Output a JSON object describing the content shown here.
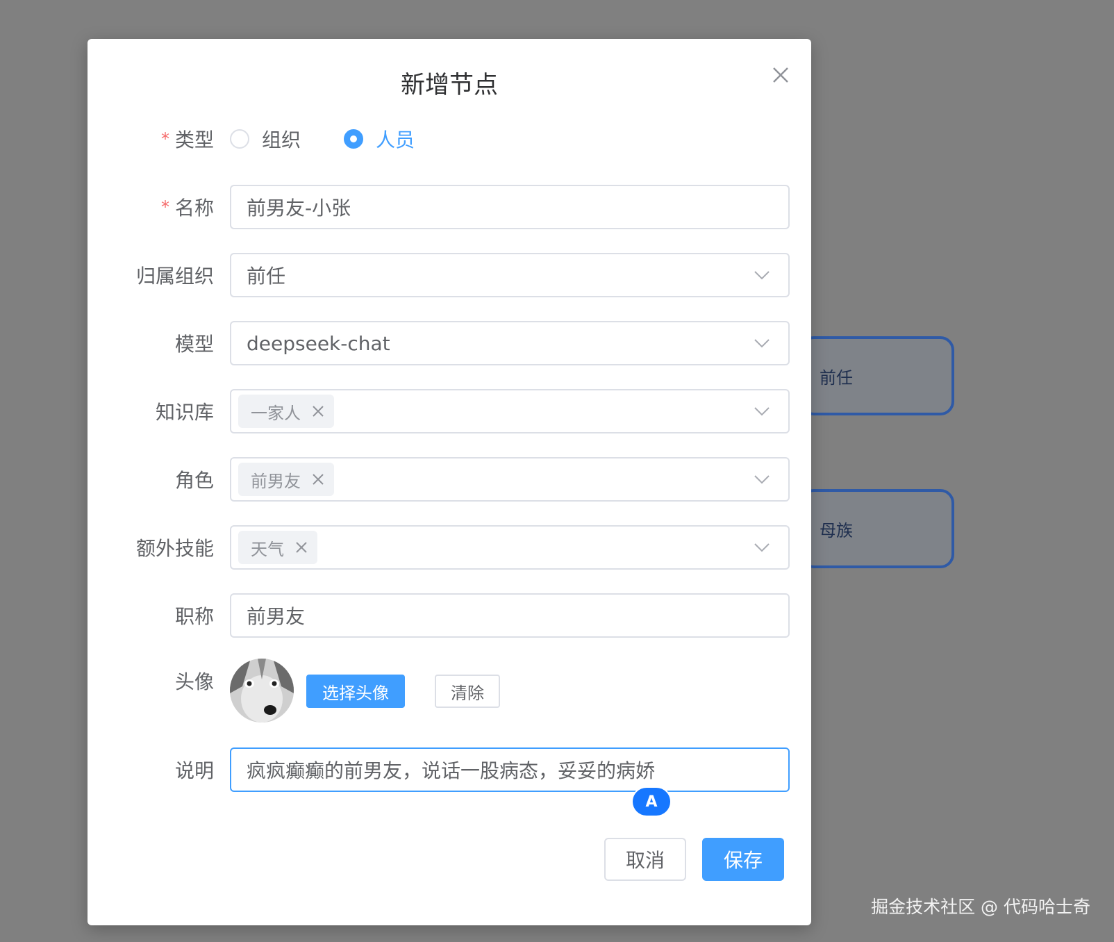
{
  "background": {
    "nodes": [
      "前任",
      "母族"
    ],
    "watermark": "掘金技术社区 @ 代码哈士奇"
  },
  "dialog": {
    "title": "新增节点",
    "fields": {
      "type": {
        "label": "类型",
        "required_mark": "*",
        "options": [
          "组织",
          "人员"
        ],
        "selected": "人员"
      },
      "name": {
        "label": "名称",
        "required_mark": "*",
        "value": "前男友-小张"
      },
      "org": {
        "label": "归属组织",
        "value": "前任"
      },
      "model": {
        "label": "模型",
        "value": "deepseek-chat"
      },
      "knowledge": {
        "label": "知识库",
        "tag": "一家人"
      },
      "role": {
        "label": "角色",
        "tag": "前男友"
      },
      "skills": {
        "label": "额外技能",
        "tag": "天气"
      },
      "job_title": {
        "label": "职称",
        "value": "前男友"
      },
      "avatar": {
        "label": "头像",
        "choose": "选择头像",
        "clear": "清除"
      },
      "desc": {
        "label": "说明",
        "value": "疯疯癫癫的前男友，说话一股病态，妥妥的病娇"
      }
    },
    "ime_badge": "A",
    "buttons": {
      "cancel": "取消",
      "save": "保存"
    }
  },
  "colors": {
    "primary": "#409eff",
    "required": "#f56c6c",
    "node_border": "#2f5aa6",
    "overlay": "#808080"
  }
}
